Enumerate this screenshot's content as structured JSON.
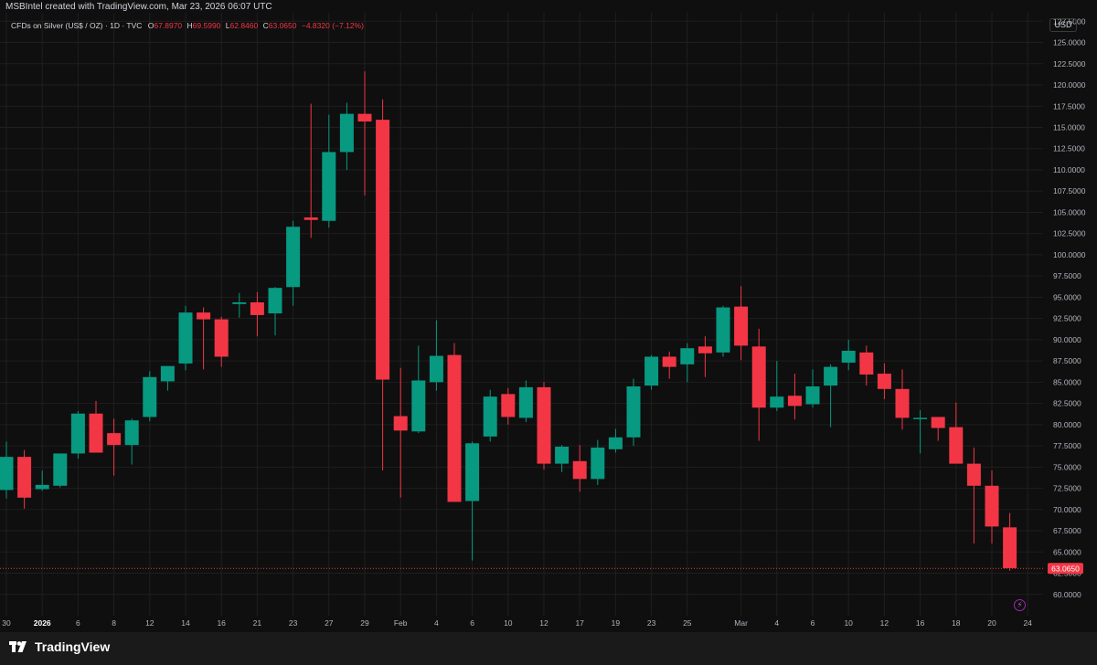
{
  "header": {
    "credit": "MSBIntel created with TradingView.com, Mar 23, 2026 06:07 UTC"
  },
  "legend": {
    "symbol": "CFDs on Silver (US$ / OZ) · 1D · TVC",
    "o_label": "O",
    "o_value": "67.8970",
    "h_label": "H",
    "h_value": "69.5990",
    "l_label": "L",
    "l_value": "62.8460",
    "c_label": "C",
    "c_value": "63.0650",
    "change": "−4.8320 (−7.12%)"
  },
  "currency": "USD",
  "footer": {
    "logo_text": "TradingView"
  },
  "colors": {
    "up": "#089981",
    "down": "#f23645",
    "background": "#0f0f0f",
    "grid": "#1f1f1f",
    "axis_text": "#b2b5be"
  },
  "icons": {
    "alert": "lightning-icon",
    "logo": "tradingview-logo-icon"
  },
  "chart_data": {
    "type": "candlestick",
    "title": "CFDs on Silver (US$ / OZ) · 1D · TVC",
    "ylabel": "USD",
    "ylim": [
      57.5,
      128.5
    ],
    "grid": true,
    "y_ticks": [
      "60.0000",
      "62.5000",
      "65.0000",
      "67.5000",
      "70.0000",
      "72.5000",
      "75.0000",
      "77.5000",
      "80.0000",
      "82.5000",
      "85.0000",
      "87.5000",
      "90.0000",
      "92.5000",
      "95.0000",
      "97.5000",
      "100.0000",
      "102.5000",
      "105.0000",
      "107.5000",
      "110.0000",
      "112.5000",
      "115.0000",
      "117.5000",
      "120.0000",
      "122.5000",
      "125.0000",
      "127.5000"
    ],
    "x_ticks": [
      {
        "label": "30",
        "bar": 0
      },
      {
        "label": "2026",
        "bar": 2,
        "bold": true
      },
      {
        "label": "6",
        "bar": 4
      },
      {
        "label": "8",
        "bar": 6
      },
      {
        "label": "12",
        "bar": 8
      },
      {
        "label": "14",
        "bar": 10
      },
      {
        "label": "16",
        "bar": 12
      },
      {
        "label": "21",
        "bar": 14
      },
      {
        "label": "23",
        "bar": 16
      },
      {
        "label": "27",
        "bar": 18
      },
      {
        "label": "29",
        "bar": 20
      },
      {
        "label": "Feb",
        "bar": 22
      },
      {
        "label": "4",
        "bar": 24
      },
      {
        "label": "6",
        "bar": 26
      },
      {
        "label": "10",
        "bar": 28
      },
      {
        "label": "12",
        "bar": 30
      },
      {
        "label": "17",
        "bar": 32
      },
      {
        "label": "19",
        "bar": 34
      },
      {
        "label": "23",
        "bar": 36
      },
      {
        "label": "25",
        "bar": 38
      },
      {
        "label": "Mar",
        "bar": 41
      },
      {
        "label": "4",
        "bar": 43
      },
      {
        "label": "6",
        "bar": 45
      },
      {
        "label": "10",
        "bar": 47
      },
      {
        "label": "12",
        "bar": 49
      },
      {
        "label": "16",
        "bar": 51
      },
      {
        "label": "18",
        "bar": 53
      },
      {
        "label": "20",
        "bar": 55
      },
      {
        "label": "24",
        "bar": 57
      }
    ],
    "last_price": "63.0650",
    "candles": [
      {
        "o": 72.3,
        "h": 78.0,
        "l": 71.3,
        "c": 76.2
      },
      {
        "o": 76.2,
        "h": 77.0,
        "l": 70.1,
        "c": 71.4
      },
      {
        "o": 72.4,
        "h": 74.6,
        "l": 72.2,
        "c": 72.9
      },
      {
        "o": 72.8,
        "h": 76.6,
        "l": 72.6,
        "c": 76.6
      },
      {
        "o": 76.6,
        "h": 81.6,
        "l": 76.0,
        "c": 81.3
      },
      {
        "o": 81.3,
        "h": 82.8,
        "l": 77.4,
        "c": 76.7
      },
      {
        "o": 79.0,
        "h": 80.7,
        "l": 74.0,
        "c": 77.6
      },
      {
        "o": 77.6,
        "h": 80.7,
        "l": 75.3,
        "c": 80.5
      },
      {
        "o": 80.9,
        "h": 86.3,
        "l": 80.4,
        "c": 85.6
      },
      {
        "o": 85.1,
        "h": 86.9,
        "l": 84.0,
        "c": 86.9
      },
      {
        "o": 87.2,
        "h": 94.0,
        "l": 86.4,
        "c": 93.2
      },
      {
        "o": 93.2,
        "h": 93.8,
        "l": 86.5,
        "c": 92.4
      },
      {
        "o": 92.4,
        "h": 92.7,
        "l": 86.8,
        "c": 88.0
      },
      {
        "o": 94.2,
        "h": 95.5,
        "l": 92.6,
        "c": 94.4
      },
      {
        "o": 94.4,
        "h": 95.6,
        "l": 90.4,
        "c": 92.9
      },
      {
        "o": 93.1,
        "h": 96.2,
        "l": 90.5,
        "c": 96.1
      },
      {
        "o": 96.2,
        "h": 104.0,
        "l": 94.0,
        "c": 103.3
      },
      {
        "o": 104.4,
        "h": 117.8,
        "l": 102.0,
        "c": 104.1
      },
      {
        "o": 104.0,
        "h": 116.5,
        "l": 103.2,
        "c": 112.1
      },
      {
        "o": 112.1,
        "h": 117.9,
        "l": 110.0,
        "c": 116.6
      },
      {
        "o": 116.6,
        "h": 121.6,
        "l": 107.0,
        "c": 115.7
      },
      {
        "o": 115.9,
        "h": 118.3,
        "l": 74.6,
        "c": 85.3
      },
      {
        "o": 81.0,
        "h": 86.7,
        "l": 71.4,
        "c": 79.3
      },
      {
        "o": 79.2,
        "h": 89.3,
        "l": 79.0,
        "c": 85.2
      },
      {
        "o": 85.0,
        "h": 92.3,
        "l": 84.0,
        "c": 88.1
      },
      {
        "o": 88.2,
        "h": 89.6,
        "l": 70.9,
        "c": 70.9
      },
      {
        "o": 71.0,
        "h": 78.0,
        "l": 64.0,
        "c": 77.8
      },
      {
        "o": 78.6,
        "h": 84.1,
        "l": 78.0,
        "c": 83.3
      },
      {
        "o": 83.6,
        "h": 84.3,
        "l": 80.0,
        "c": 80.9
      },
      {
        "o": 80.8,
        "h": 85.2,
        "l": 80.3,
        "c": 84.4
      },
      {
        "o": 84.4,
        "h": 85.0,
        "l": 74.7,
        "c": 75.4
      },
      {
        "o": 75.4,
        "h": 77.6,
        "l": 74.4,
        "c": 77.4
      },
      {
        "o": 75.7,
        "h": 77.6,
        "l": 72.1,
        "c": 73.6
      },
      {
        "o": 73.6,
        "h": 78.2,
        "l": 72.9,
        "c": 77.3
      },
      {
        "o": 77.1,
        "h": 79.5,
        "l": 76.7,
        "c": 78.5
      },
      {
        "o": 78.5,
        "h": 85.4,
        "l": 77.5,
        "c": 84.5
      },
      {
        "o": 84.6,
        "h": 88.2,
        "l": 84.1,
        "c": 88.0
      },
      {
        "o": 88.0,
        "h": 88.6,
        "l": 85.4,
        "c": 86.8
      },
      {
        "o": 87.1,
        "h": 89.6,
        "l": 85.0,
        "c": 89.0
      },
      {
        "o": 89.2,
        "h": 90.4,
        "l": 85.6,
        "c": 88.4
      },
      {
        "o": 88.5,
        "h": 94.0,
        "l": 88.0,
        "c": 93.8
      },
      {
        "o": 93.9,
        "h": 96.3,
        "l": 87.6,
        "c": 89.3
      },
      {
        "o": 89.2,
        "h": 91.3,
        "l": 78.1,
        "c": 82.0
      },
      {
        "o": 82.0,
        "h": 87.5,
        "l": 81.6,
        "c": 83.3
      },
      {
        "o": 83.4,
        "h": 86.0,
        "l": 80.6,
        "c": 82.2
      },
      {
        "o": 82.4,
        "h": 86.5,
        "l": 82.0,
        "c": 84.5
      },
      {
        "o": 84.6,
        "h": 87.1,
        "l": 79.7,
        "c": 86.8
      },
      {
        "o": 87.3,
        "h": 90.0,
        "l": 86.4,
        "c": 88.7
      },
      {
        "o": 88.5,
        "h": 89.3,
        "l": 84.6,
        "c": 85.9
      },
      {
        "o": 86.0,
        "h": 87.2,
        "l": 83.0,
        "c": 84.2
      },
      {
        "o": 84.2,
        "h": 86.5,
        "l": 79.4,
        "c": 80.8
      },
      {
        "o": 80.7,
        "h": 81.7,
        "l": 76.6,
        "c": 80.8
      },
      {
        "o": 80.9,
        "h": 80.9,
        "l": 78.1,
        "c": 79.6
      },
      {
        "o": 79.7,
        "h": 82.6,
        "l": 77.4,
        "c": 75.4
      },
      {
        "o": 75.4,
        "h": 77.3,
        "l": 66.0,
        "c": 72.8
      },
      {
        "o": 72.8,
        "h": 74.6,
        "l": 66.0,
        "c": 68.0
      },
      {
        "o": 67.9,
        "h": 69.6,
        "l": 62.8,
        "c": 63.1
      }
    ]
  }
}
